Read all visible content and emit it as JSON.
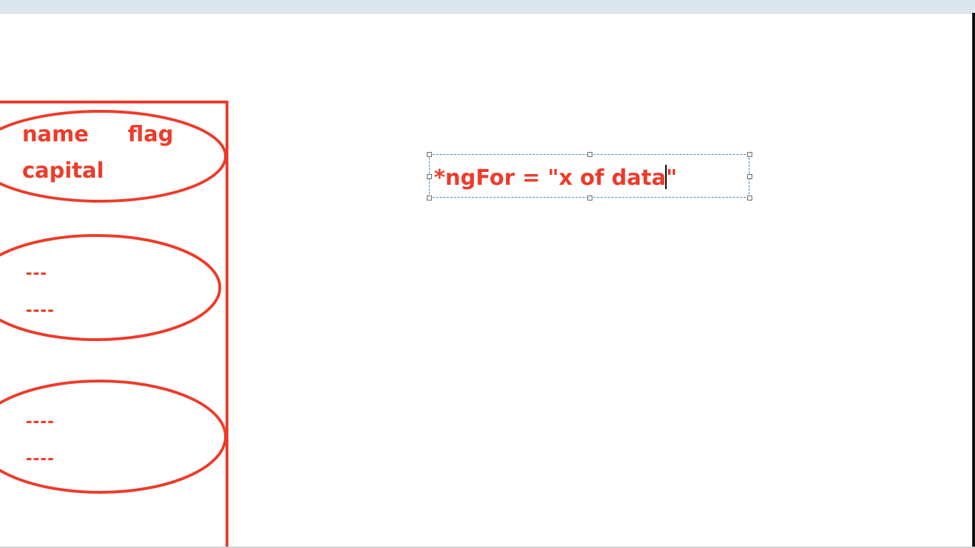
{
  "diagram": {
    "header_group": {
      "name_label": "name",
      "flag_label": "flag",
      "capital_label": "capital"
    },
    "item_group_1": {
      "line_1": "---",
      "line_2": "----"
    },
    "item_group_2": {
      "line_1": "----",
      "line_2": "----"
    },
    "annotation": {
      "text_before_caret": "*ngFor = \"x of data",
      "text_after_caret": "\""
    },
    "colors": {
      "ink": "#ee3b2a",
      "selection": "#3a86c8",
      "caret": "#000000"
    }
  }
}
